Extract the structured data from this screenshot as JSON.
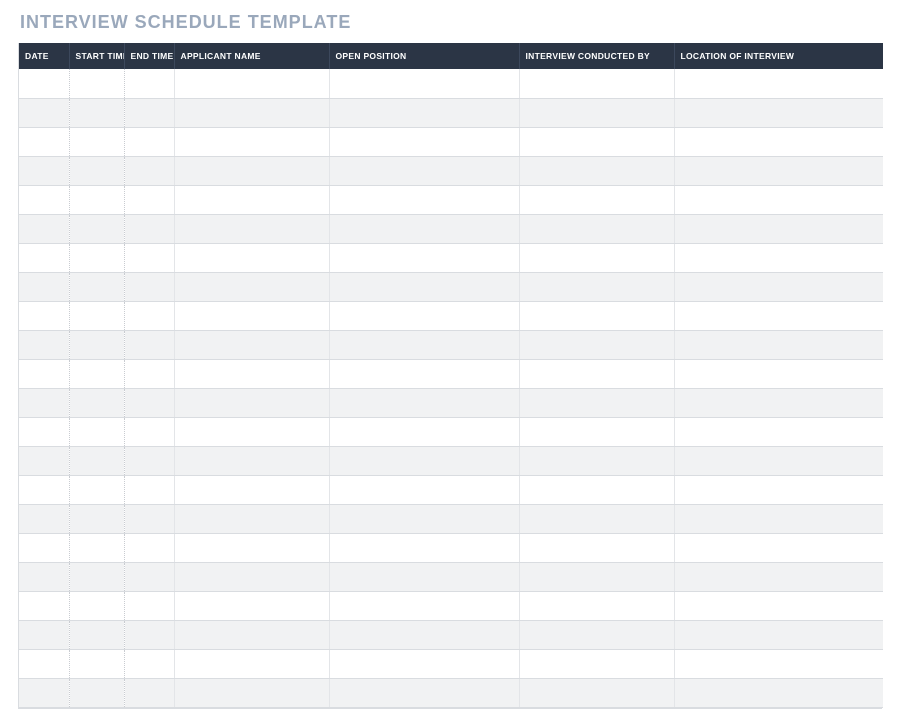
{
  "title": "INTERVIEW SCHEDULE TEMPLATE",
  "columns": {
    "date": "DATE",
    "start_time": "START TIME",
    "end_time": "END TIME",
    "applicant_name": "APPLICANT NAME",
    "open_position": "OPEN POSITION",
    "interview_conducted_by": "INTERVIEW CONDUCTED BY",
    "location_of_interview": "LOCATION OF INTERVIEW"
  },
  "rows": [
    {
      "date": "",
      "start_time": "",
      "end_time": "",
      "applicant_name": "",
      "open_position": "",
      "interview_conducted_by": "",
      "location_of_interview": ""
    },
    {
      "date": "",
      "start_time": "",
      "end_time": "",
      "applicant_name": "",
      "open_position": "",
      "interview_conducted_by": "",
      "location_of_interview": ""
    },
    {
      "date": "",
      "start_time": "",
      "end_time": "",
      "applicant_name": "",
      "open_position": "",
      "interview_conducted_by": "",
      "location_of_interview": ""
    },
    {
      "date": "",
      "start_time": "",
      "end_time": "",
      "applicant_name": "",
      "open_position": "",
      "interview_conducted_by": "",
      "location_of_interview": ""
    },
    {
      "date": "",
      "start_time": "",
      "end_time": "",
      "applicant_name": "",
      "open_position": "",
      "interview_conducted_by": "",
      "location_of_interview": ""
    },
    {
      "date": "",
      "start_time": "",
      "end_time": "",
      "applicant_name": "",
      "open_position": "",
      "interview_conducted_by": "",
      "location_of_interview": ""
    },
    {
      "date": "",
      "start_time": "",
      "end_time": "",
      "applicant_name": "",
      "open_position": "",
      "interview_conducted_by": "",
      "location_of_interview": ""
    },
    {
      "date": "",
      "start_time": "",
      "end_time": "",
      "applicant_name": "",
      "open_position": "",
      "interview_conducted_by": "",
      "location_of_interview": ""
    },
    {
      "date": "",
      "start_time": "",
      "end_time": "",
      "applicant_name": "",
      "open_position": "",
      "interview_conducted_by": "",
      "location_of_interview": ""
    },
    {
      "date": "",
      "start_time": "",
      "end_time": "",
      "applicant_name": "",
      "open_position": "",
      "interview_conducted_by": "",
      "location_of_interview": ""
    },
    {
      "date": "",
      "start_time": "",
      "end_time": "",
      "applicant_name": "",
      "open_position": "",
      "interview_conducted_by": "",
      "location_of_interview": ""
    },
    {
      "date": "",
      "start_time": "",
      "end_time": "",
      "applicant_name": "",
      "open_position": "",
      "interview_conducted_by": "",
      "location_of_interview": ""
    },
    {
      "date": "",
      "start_time": "",
      "end_time": "",
      "applicant_name": "",
      "open_position": "",
      "interview_conducted_by": "",
      "location_of_interview": ""
    },
    {
      "date": "",
      "start_time": "",
      "end_time": "",
      "applicant_name": "",
      "open_position": "",
      "interview_conducted_by": "",
      "location_of_interview": ""
    },
    {
      "date": "",
      "start_time": "",
      "end_time": "",
      "applicant_name": "",
      "open_position": "",
      "interview_conducted_by": "",
      "location_of_interview": ""
    },
    {
      "date": "",
      "start_time": "",
      "end_time": "",
      "applicant_name": "",
      "open_position": "",
      "interview_conducted_by": "",
      "location_of_interview": ""
    },
    {
      "date": "",
      "start_time": "",
      "end_time": "",
      "applicant_name": "",
      "open_position": "",
      "interview_conducted_by": "",
      "location_of_interview": ""
    },
    {
      "date": "",
      "start_time": "",
      "end_time": "",
      "applicant_name": "",
      "open_position": "",
      "interview_conducted_by": "",
      "location_of_interview": ""
    },
    {
      "date": "",
      "start_time": "",
      "end_time": "",
      "applicant_name": "",
      "open_position": "",
      "interview_conducted_by": "",
      "location_of_interview": ""
    },
    {
      "date": "",
      "start_time": "",
      "end_time": "",
      "applicant_name": "",
      "open_position": "",
      "interview_conducted_by": "",
      "location_of_interview": ""
    },
    {
      "date": "",
      "start_time": "",
      "end_time": "",
      "applicant_name": "",
      "open_position": "",
      "interview_conducted_by": "",
      "location_of_interview": ""
    },
    {
      "date": "",
      "start_time": "",
      "end_time": "",
      "applicant_name": "",
      "open_position": "",
      "interview_conducted_by": "",
      "location_of_interview": ""
    }
  ]
}
